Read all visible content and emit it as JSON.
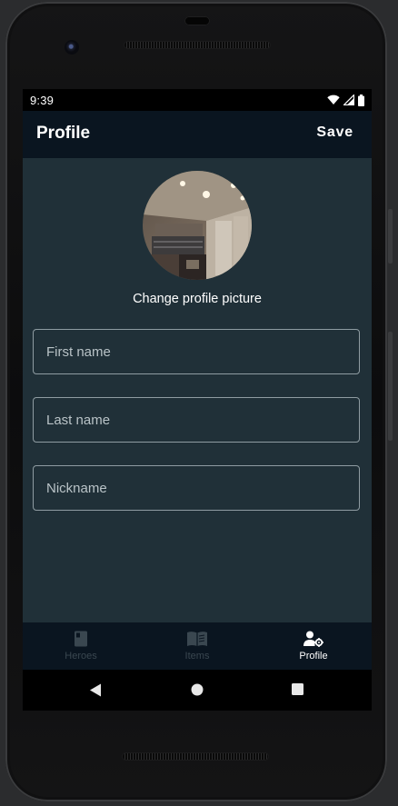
{
  "status_bar": {
    "time": "9:39"
  },
  "app_bar": {
    "title": "Profile",
    "save_label": "Save"
  },
  "profile": {
    "change_picture_label": "Change profile picture"
  },
  "form": {
    "first_name": {
      "placeholder": "First name",
      "value": ""
    },
    "last_name": {
      "placeholder": "Last name",
      "value": ""
    },
    "nickname": {
      "placeholder": "Nickname",
      "value": ""
    }
  },
  "bottom_nav": {
    "items": [
      {
        "label": "Heroes",
        "icon": "book-icon",
        "active": false
      },
      {
        "label": "Items",
        "icon": "open-book-icon",
        "active": false
      },
      {
        "label": "Profile",
        "icon": "person-settings-icon",
        "active": true
      }
    ]
  },
  "system_nav": {
    "icons": [
      "back-triangle-icon",
      "home-circle-icon",
      "recents-square-icon"
    ]
  },
  "colors": {
    "app_bar_bg": "#0a1520",
    "content_bg": "#203038",
    "inactive_nav": "#3a4750",
    "active_nav": "#ffffff",
    "field_border": "#8f9ca2"
  }
}
